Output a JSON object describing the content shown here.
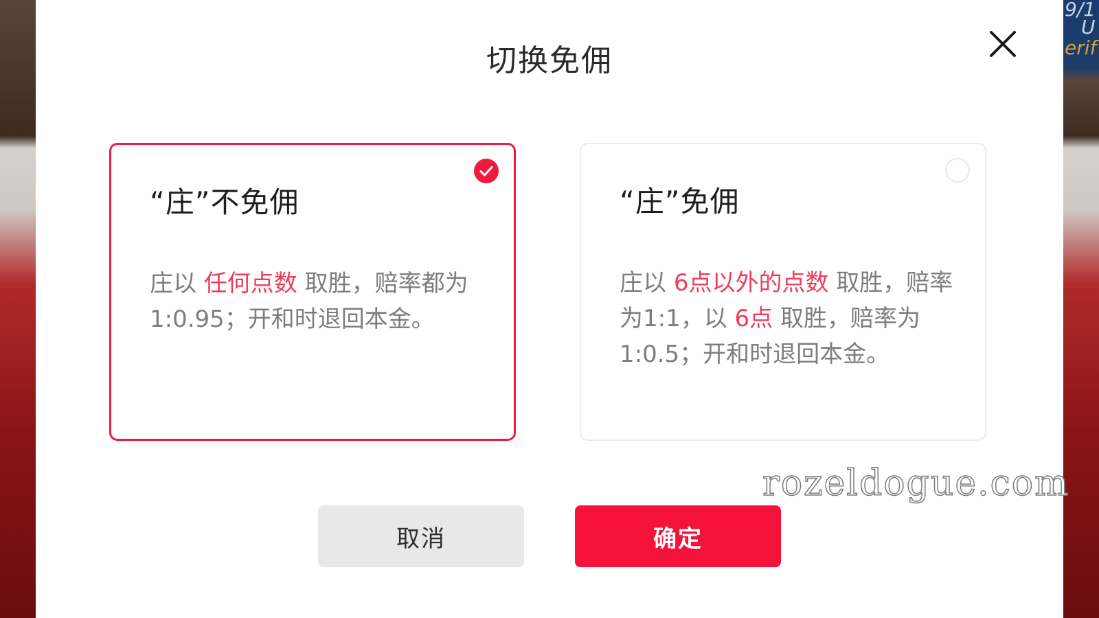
{
  "background": {
    "right_text": [
      "9/1",
      "U",
      "erif"
    ]
  },
  "modal": {
    "title": "切换免佣",
    "close_icon": "close-icon"
  },
  "options": [
    {
      "title": "“庄”不免佣",
      "selected": true,
      "desc_parts": [
        {
          "text": "庄以 ",
          "highlight": false
        },
        {
          "text": "任何点数",
          "highlight": true
        },
        {
          "text": " 取胜，赔率都为1:0.95；开和时退回本金。",
          "highlight": false
        }
      ]
    },
    {
      "title": "“庄”免佣",
      "selected": false,
      "desc_parts": [
        {
          "text": "庄以 ",
          "highlight": false
        },
        {
          "text": "6点以外的点数",
          "highlight": true
        },
        {
          "text": " 取胜，赔率为1:1，以 ",
          "highlight": false
        },
        {
          "text": "6点",
          "highlight": true
        },
        {
          "text": " 取胜，赔率为1:0.5；开和时退回本金。",
          "highlight": false
        }
      ]
    }
  ],
  "buttons": {
    "cancel_label": "取消",
    "confirm_label": "确定"
  },
  "watermark": "rozeldogue.com",
  "colors": {
    "accent": "#ee1b3e",
    "confirm_bg": "#f5123a",
    "cancel_bg": "#e8e8e8",
    "desc_text": "#7d7d7d"
  }
}
